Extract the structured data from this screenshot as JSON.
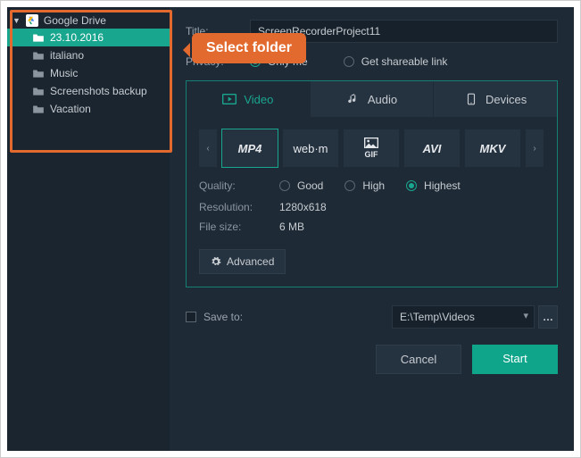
{
  "callout": "Select folder",
  "sidebar": {
    "root_label": "Google Drive",
    "items": [
      {
        "label": "23.10.2016",
        "selected": true
      },
      {
        "label": "italiano",
        "selected": false
      },
      {
        "label": "Music",
        "selected": false
      },
      {
        "label": "Screenshots backup",
        "selected": false
      },
      {
        "label": "Vacation",
        "selected": false
      }
    ]
  },
  "form": {
    "title_label": "Title:",
    "title_value": "ScreenRecorderProject11",
    "privacy_label": "Privacy:",
    "privacy_options": [
      {
        "label": "Only me",
        "selected": true
      },
      {
        "label": "Get shareable link",
        "selected": false
      }
    ]
  },
  "tabs": [
    {
      "label": "Video",
      "active": true,
      "icon": "video-icon"
    },
    {
      "label": "Audio",
      "active": false,
      "icon": "music-icon"
    },
    {
      "label": "Devices",
      "active": false,
      "icon": "devices-icon"
    }
  ],
  "formats": [
    {
      "label": "MP4",
      "selected": true
    },
    {
      "label": "web·m",
      "selected": false
    },
    {
      "label": "GIF",
      "selected": false
    },
    {
      "label": "AVI",
      "selected": false
    },
    {
      "label": "MKV",
      "selected": false
    }
  ],
  "quality": {
    "label": "Quality:",
    "options": [
      {
        "label": "Good",
        "selected": false
      },
      {
        "label": "High",
        "selected": false
      },
      {
        "label": "Highest",
        "selected": true
      }
    ]
  },
  "resolution": {
    "label": "Resolution:",
    "value": "1280x618"
  },
  "filesize": {
    "label": "File size:",
    "value": "6 MB"
  },
  "advanced_label": "Advanced",
  "save_to": {
    "label": "Save to:",
    "checked": false,
    "path": "E:\\Temp\\Videos"
  },
  "actions": {
    "cancel": "Cancel",
    "start": "Start"
  },
  "colors": {
    "accent": "#19a68f",
    "callout": "#e36a2e",
    "bg": "#1e2a36"
  }
}
